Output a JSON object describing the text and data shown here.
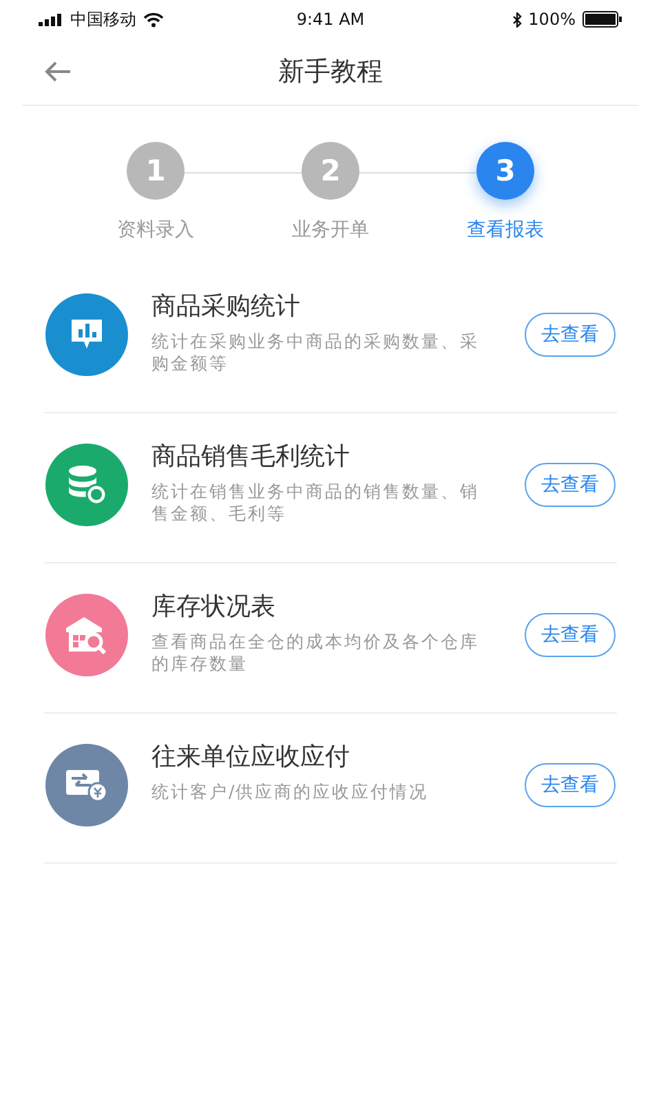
{
  "status_bar": {
    "carrier": "中国移动",
    "time": "9:41 AM",
    "battery": "100%"
  },
  "nav": {
    "title": "新手教程"
  },
  "steps": [
    {
      "number": "1",
      "label": "资料录入",
      "selected": false
    },
    {
      "number": "2",
      "label": "业务开单",
      "selected": false
    },
    {
      "number": "3",
      "label": "查看报表",
      "selected": true
    }
  ],
  "reports": [
    {
      "kind": "chart",
      "color": "#1a8fd0",
      "title": "商品采购统计",
      "description": "统计在采购业务中商品的采购数量、采购金额等",
      "button": "去查看"
    },
    {
      "kind": "database",
      "color": "#1aab6c",
      "title": "商品销售毛利统计",
      "description": "统计在销售业务中商品的销售数量、销售金额、毛利等",
      "button": "去查看"
    },
    {
      "kind": "warehouse",
      "color": "#f27a97",
      "title": "库存状况表",
      "description": "查看商品在全仓的成本均价及各个仓库的库存数量",
      "button": "去查看"
    },
    {
      "kind": "exchange",
      "color": "#6e87a7",
      "title": "往来单位应收应付",
      "description": "统计客户/供应商的应收应付情况",
      "button": "去查看"
    }
  ]
}
